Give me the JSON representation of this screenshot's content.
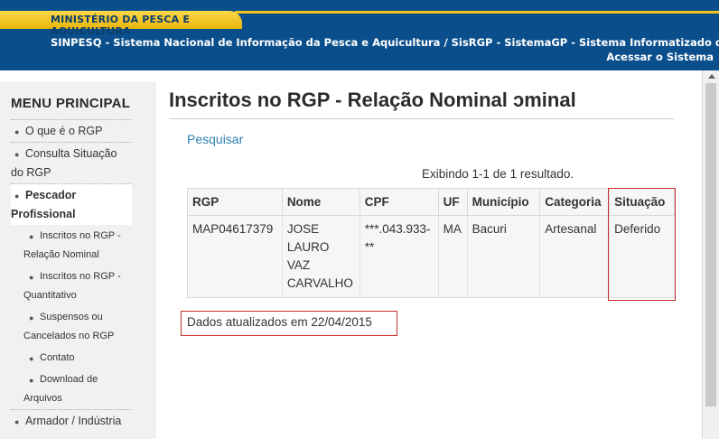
{
  "header": {
    "ministry": "MINISTÉRIO DA PESCA E AQUICULTURA",
    "system_title": "SINPESQ - Sistema Nacional de Informação da Pesca e Aquicultura / SisRGP - SistemaGP - Sistema Informatizado do",
    "login_link": "Acessar o Sistema"
  },
  "sidebar": {
    "title": "MENU PRINCIPAL",
    "items": [
      {
        "label": "O que é o RGP",
        "level": 1
      },
      {
        "label": "Consulta Situação do RGP",
        "level": 1
      },
      {
        "label": "Pescador Profissional",
        "level": 1,
        "active": true
      },
      {
        "label": "Inscritos no RGP - Relação Nominal",
        "level": 2
      },
      {
        "label": "Inscritos no RGP - Quantitativo",
        "level": 2
      },
      {
        "label": "Suspensos ou Cancelados no RGP",
        "level": 2
      },
      {
        "label": "Contato",
        "level": 2
      },
      {
        "label": "Download de Arquivos",
        "level": 2
      },
      {
        "label": "Armador / Indústria",
        "level": 1
      }
    ]
  },
  "main": {
    "title": "Inscritos no RGP - Relação Nominal ɔminal",
    "search_link": "Pesquisar",
    "summary": "Exibindo 1-1 de 1 resultado.",
    "table": {
      "columns": [
        "RGP",
        "Nome",
        "CPF",
        "UF",
        "Município",
        "Categoria",
        "Situação"
      ],
      "rows": [
        [
          "MAP04617379",
          "JOSE LAURO VAZ CARVALHO",
          "***.043.933-**",
          "MA",
          "Bacuri",
          "Artesanal",
          "Deferido"
        ]
      ]
    },
    "updated": "Dados atualizados em 22/04/2015"
  },
  "colors": {
    "banner": "#0a4f8c",
    "ministry_tab": "#f3c51d",
    "link": "#2f7fb3",
    "highlight_border": "#cc2b2b"
  }
}
